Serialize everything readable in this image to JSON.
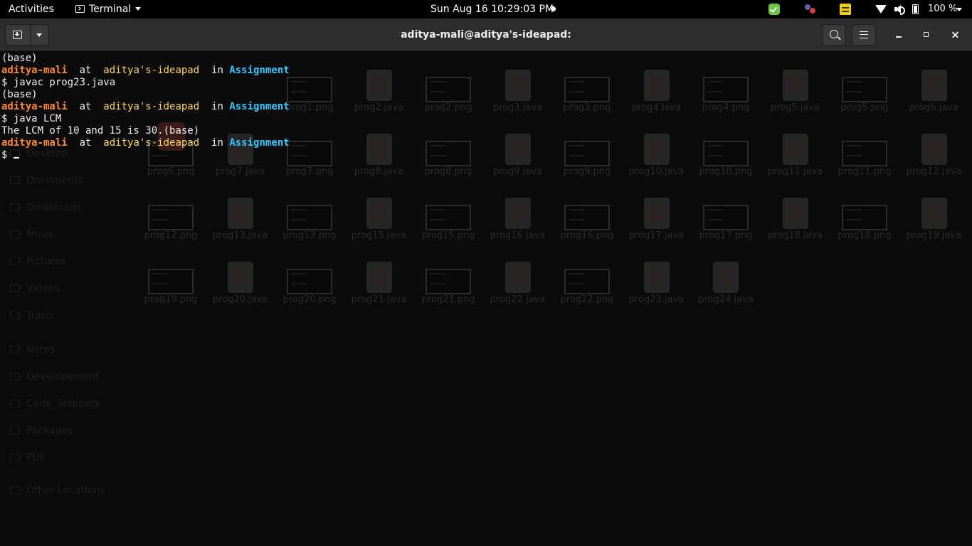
{
  "topbar": {
    "activities": "Activities",
    "app_menu": "Terminal",
    "clock": "Sun Aug 16  10:29:03 PM",
    "battery": "100 %"
  },
  "window": {
    "title": "aditya-mali@aditya's-ideapad:"
  },
  "terminal": {
    "lines": [
      {
        "type": "text",
        "text": "(base)"
      },
      {
        "type": "prompt",
        "user": "aditya-mali",
        "at": "at",
        "host": "aditya's-ideapad",
        "in": "in",
        "dir": "Assignment"
      },
      {
        "type": "text",
        "text": "$ javac prog23.java"
      },
      {
        "type": "text",
        "text": "(base)"
      },
      {
        "type": "prompt",
        "user": "aditya-mali",
        "at": "at",
        "host": "aditya's-ideapad",
        "in": "in",
        "dir": "Assignment"
      },
      {
        "type": "text",
        "text": "$ java LCM"
      },
      {
        "type": "text",
        "text": "The LCM of 10 and 15 is 30.(base)"
      },
      {
        "type": "prompt",
        "user": "aditya-mali",
        "at": "at",
        "host": "aditya's-ideapad",
        "in": "in",
        "dir": "Assignment"
      },
      {
        "type": "input",
        "text": "$ "
      }
    ]
  },
  "file_manager": {
    "sidebar": [
      "Desktop",
      "Documents",
      "Downloads",
      "Music",
      "Pictures",
      "Videos",
      "Trash",
      "Notes",
      "Developement",
      "Code_Snippets",
      "Packages",
      "PDF",
      "Other Locations"
    ],
    "files": [
      [
        "prog1.png",
        "prog2.java",
        "prog2.png",
        "prog3.java",
        "prog3.png",
        "prog4.java",
        "prog4.png",
        "prog5.java",
        "prog5.png",
        "prog6.java"
      ],
      [
        "prog6.png",
        "prog7.java",
        "prog7.png",
        "prog8.java",
        "prog8.png",
        "prog9.java",
        "prog9.png",
        "prog10.java",
        "prog10.png",
        "prog11.java",
        "prog11.png",
        "prog12.java"
      ],
      [
        "prog12.png",
        "prog13.java",
        "prog13.png",
        "prog15.java",
        "prog15.png",
        "prog16.java",
        "prog16.png",
        "prog17.java",
        "prog17.png",
        "prog18.java",
        "prog18.png",
        "prog19.java"
      ],
      [
        "prog19.png",
        "prog20.java",
        "prog20.png",
        "prog21.java",
        "prog21.png",
        "prog22.java",
        "prog22.png",
        "prog23.java",
        "prog24.java"
      ]
    ]
  }
}
